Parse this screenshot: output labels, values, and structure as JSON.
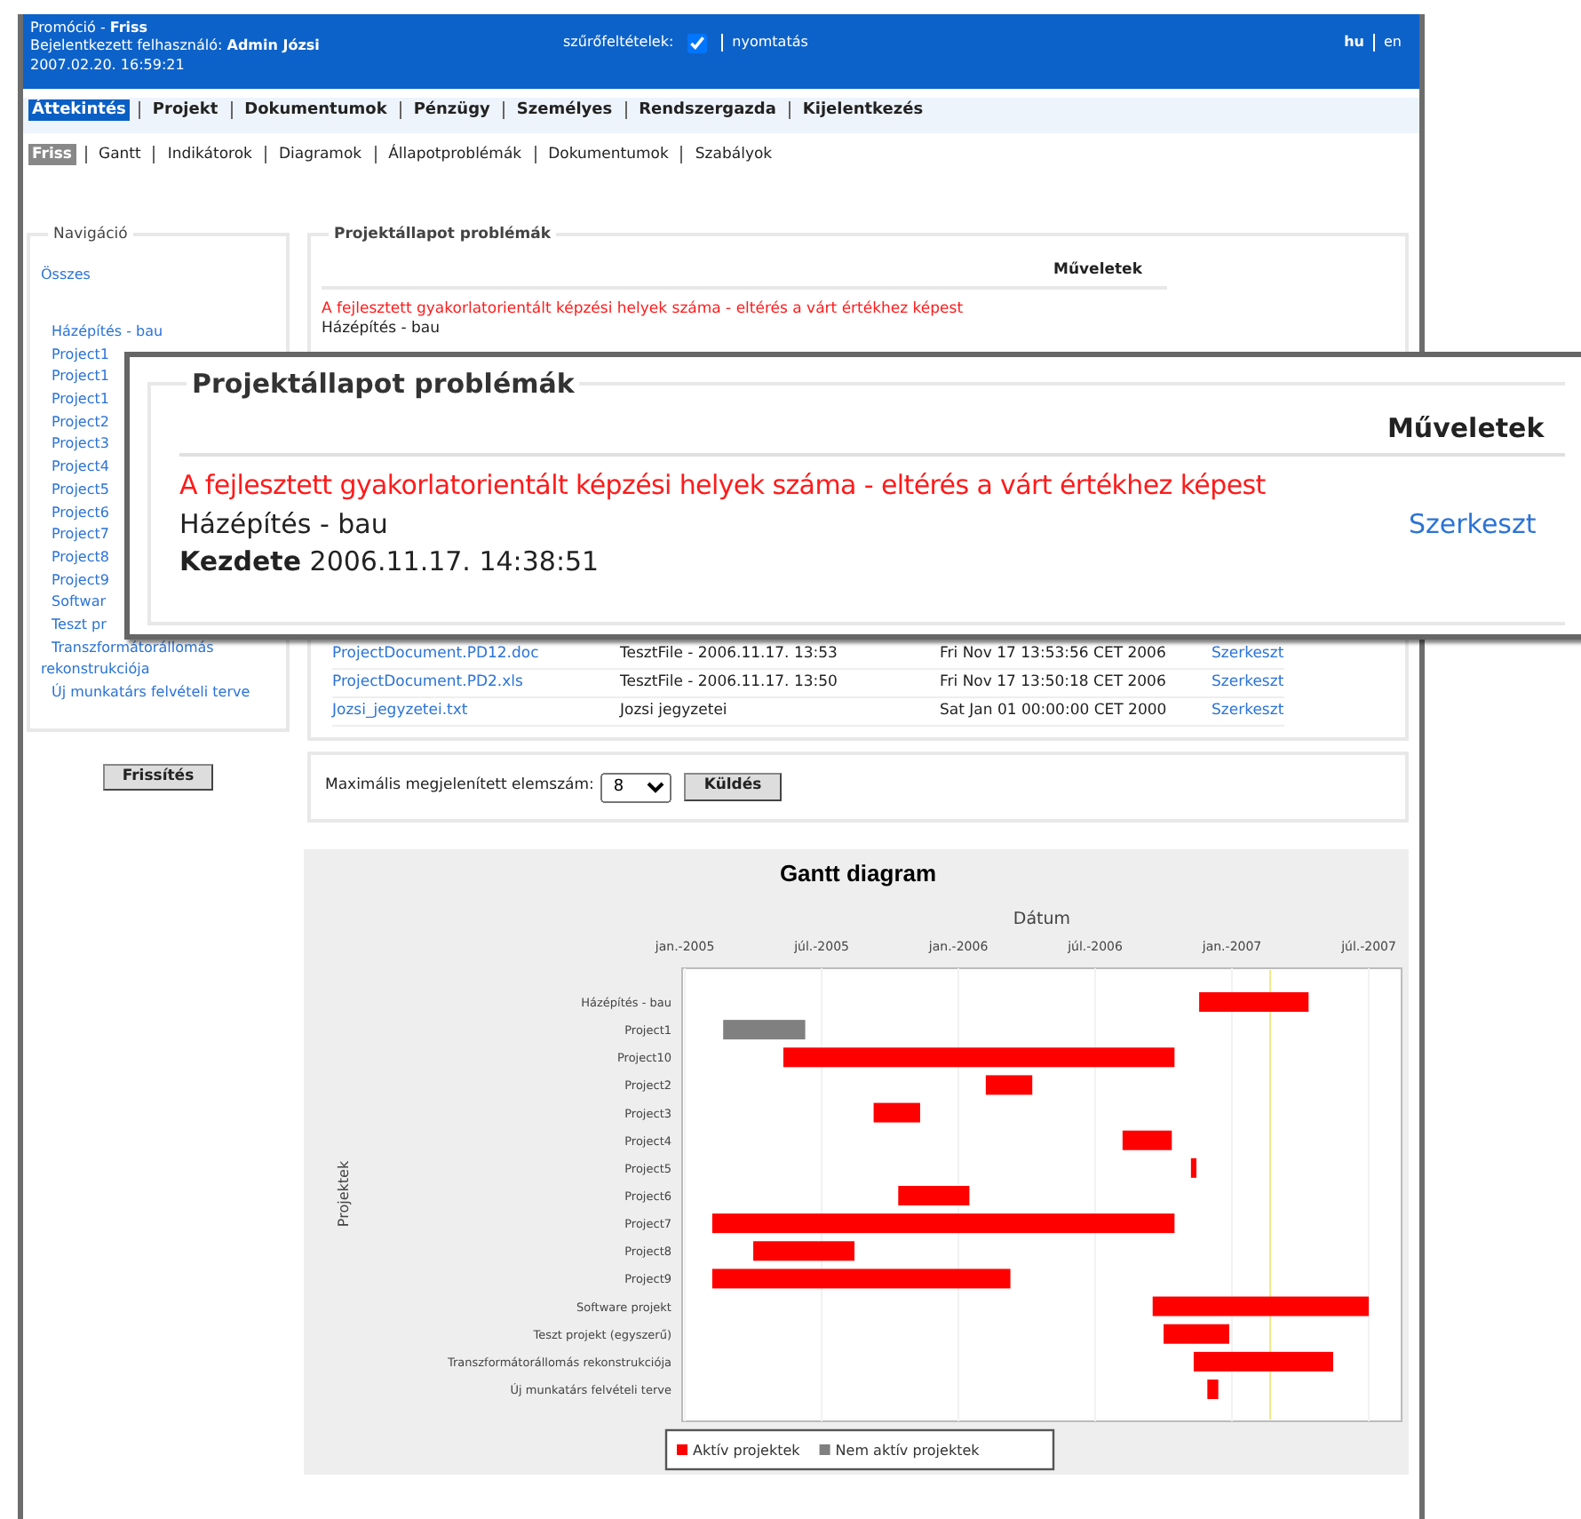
{
  "header": {
    "lines": [
      "Promóció - **Friss**",
      "Bejelentkezett felhasználó: **Admin Józsi**",
      "2007.02.20. 16:59:21"
    ],
    "filter_label": "szűrőfeltételek:",
    "filter_checked": true,
    "print_link": "nyomtatás",
    "languages": [
      {
        "label": "hu",
        "selected": true
      },
      {
        "label": "en",
        "selected": false
      }
    ]
  },
  "main_menu": [
    {
      "label": "Áttekintés",
      "selected": true
    },
    {
      "label": "Projekt",
      "selected": false
    },
    {
      "label": "Dokumentumok",
      "selected": false
    },
    {
      "label": "Pénzügy",
      "selected": false
    },
    {
      "label": "Személyes",
      "selected": false
    },
    {
      "label": "Rendszergazda",
      "selected": false
    },
    {
      "label": "Kijelentkezés",
      "selected": false
    }
  ],
  "sub_menu": [
    {
      "label": "Friss",
      "selected": true
    },
    {
      "label": "Gantt",
      "selected": false
    },
    {
      "label": "Indikátorok",
      "selected": false
    },
    {
      "label": "Diagramok",
      "selected": false
    },
    {
      "label": "Állapotproblémák",
      "selected": false
    },
    {
      "label": "Dokumentumok",
      "selected": false
    },
    {
      "label": "Szabályok",
      "selected": false
    }
  ],
  "navigation": {
    "title": "Navigáció",
    "all_link": "Összes",
    "items": [
      "Házépítés - bau",
      "Project1",
      "Project1",
      "Project1",
      "Project2",
      "Project3",
      "Project4",
      "Project5",
      "Project6",
      "Project7",
      "Project8",
      "Project9",
      "Softwar",
      "Teszt pr",
      "Transzformátorállomás rekonstrukciója",
      "Új munkatárs felvételi terve"
    ],
    "refresh_button": "Frissítés"
  },
  "problems": {
    "title": "Projektállapot problémák",
    "actions_header": "Műveletek",
    "message": "A fejlesztett gyakorlatorientált képzési helyek száma - eltérés a várt értékhez képest",
    "project": "Házépítés - bau"
  },
  "documents": [
    {
      "name": "ProjectDocument.PD12.doc",
      "description": "TesztFile - 2006.11.17. 13:53",
      "date": "Fri Nov 17 13:53:56 CET 2006",
      "action": "Szerkeszt"
    },
    {
      "name": "ProjectDocument.PD2.xls",
      "description": "TesztFile - 2006.11.17. 13:50",
      "date": "Fri Nov 17 13:50:18 CET 2006",
      "action": "Szerkeszt"
    },
    {
      "name": "Jozsi_jegyzetei.txt",
      "description": "Jozsi jegyzetei",
      "date": "Sat Jan 01 00:00:00 CET 2000",
      "action": "Szerkeszt"
    }
  ],
  "limit_form": {
    "label": "Maximális megjelenített elemszám:",
    "value": "8",
    "submit": "Küldés"
  },
  "overlay": {
    "title": "Projektállapot problémák",
    "actions_header": "Műveletek",
    "message": "A fejlesztett gyakorlatorientált képzési helyek száma - eltérés a várt értékhez képest",
    "project": "Házépítés - bau",
    "start_label": "Kezdete",
    "start_value": "2006.11.17. 14:38:51",
    "action": "Szerkeszt"
  },
  "gantt": {
    "title": "Gantt diagram",
    "xlabel": "Dátum",
    "ylabel": "Projektek",
    "tick_labels": [
      "jan.-2005",
      "júl.-2005",
      "jan.-2006",
      "júl.-2006",
      "jan.-2007",
      "júl.-2007"
    ],
    "rows": [
      {
        "label": "Házépítés - bau",
        "color": "#ff0000"
      },
      {
        "label": "Project1",
        "color": "#808080"
      },
      {
        "label": "Project10",
        "color": "#ff0000"
      },
      {
        "label": "Project2",
        "color": "#ff0000"
      },
      {
        "label": "Project3",
        "color": "#ff0000"
      },
      {
        "label": "Project4",
        "color": "#ff0000"
      },
      {
        "label": "Project5",
        "color": "#ff0000"
      },
      {
        "label": "Project6",
        "color": "#ff0000"
      },
      {
        "label": "Project7",
        "color": "#ff0000"
      },
      {
        "label": "Project8",
        "color": "#ff0000"
      },
      {
        "label": "Project9",
        "color": "#ff0000"
      },
      {
        "label": "Software projekt",
        "color": "#ff0000"
      },
      {
        "label": "Teszt projekt (egyszerű)",
        "color": "#ff0000"
      },
      {
        "label": "Transzformátorállomás rekonstrukciója",
        "color": "#ff0000"
      },
      {
        "label": "Új munkatárs felvételi terve",
        "color": "#ff0000"
      }
    ],
    "legend": [
      {
        "label": "Aktív projektek",
        "color": "#ff0000"
      },
      {
        "label": "Nem aktív projektek",
        "color": "#808080"
      }
    ]
  }
}
